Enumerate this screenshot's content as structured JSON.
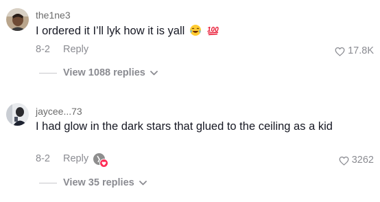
{
  "comments": [
    {
      "username": "the1ne3",
      "text": "I ordered it I’ll lyk how it is yall",
      "emojis": [
        "laughing-crying-emoji",
        "hundred-points-emoji"
      ],
      "date": "8-2",
      "reply_label": "Reply",
      "likes": "17.8K",
      "view_replies": "View 1088 replies"
    },
    {
      "username": "jaycee...73",
      "text": "I had glow in the dark stars that glued to the ceiling as a kid",
      "date": "8-2",
      "reply_label": "Reply",
      "likes": "3262",
      "view_replies": "View 35 replies",
      "creator_liked": true
    }
  ],
  "colors": {
    "text": "#161823",
    "muted": "#8a8b91",
    "accent": "#fe2c55"
  },
  "icons": [
    "heart-outline-icon",
    "chevron-down-icon"
  ]
}
